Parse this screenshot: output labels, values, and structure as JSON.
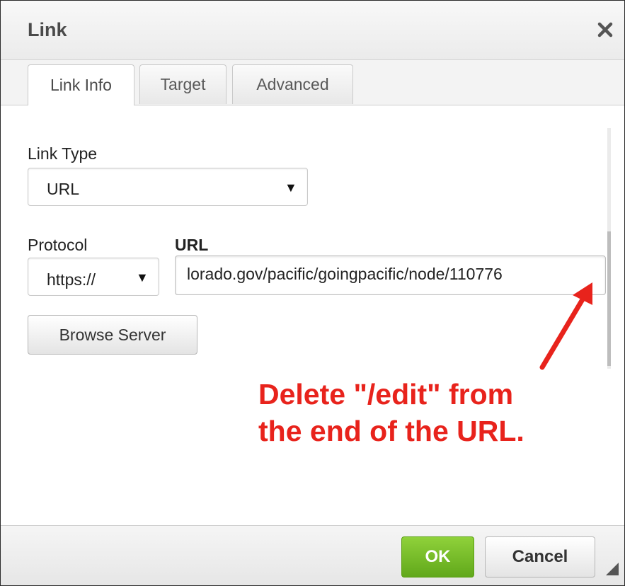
{
  "dialog": {
    "title": "Link",
    "close_icon": "close-icon"
  },
  "tabs": [
    {
      "label": "Link Info",
      "active": true
    },
    {
      "label": "Target",
      "active": false
    },
    {
      "label": "Advanced",
      "active": false
    }
  ],
  "link_type": {
    "label": "Link Type",
    "value": "URL"
  },
  "protocol": {
    "label": "Protocol",
    "value": "https://"
  },
  "url": {
    "label": "URL",
    "value": "lorado.gov/pacific/goingpacific/node/110776"
  },
  "browse_server_label": "Browse Server",
  "annotation": {
    "line1": "Delete \"/edit\" from",
    "line2": "the end of the URL.",
    "color": "#e8231c"
  },
  "footer": {
    "ok_label": "OK",
    "cancel_label": "Cancel"
  },
  "colors": {
    "ok_button": "#6bb526",
    "annotation": "#e8231c"
  }
}
